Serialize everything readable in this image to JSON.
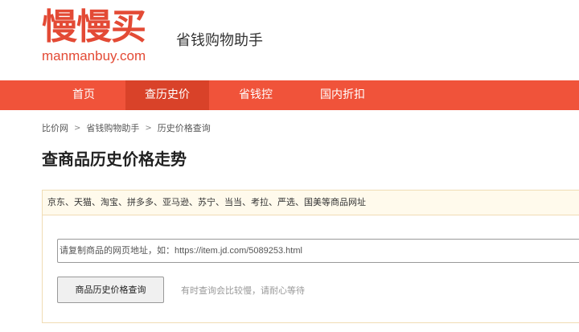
{
  "logo": {
    "cn": "慢慢买",
    "en": "manmanbuy.com"
  },
  "slogan": "省钱购物助手",
  "nav": {
    "items": [
      {
        "label": "首页"
      },
      {
        "label": "查历史价"
      },
      {
        "label": "省钱控"
      },
      {
        "label": "国内折扣"
      }
    ],
    "active_index": 1
  },
  "breadcrumb": {
    "items": [
      "比价网",
      "省钱购物助手",
      "历史价格查询"
    ],
    "separator": ">"
  },
  "page_title": "查商品历史价格走势",
  "panel": {
    "supported_sites": "京东、天猫、淘宝、拼多多、亚马逊、苏宁、当当、考拉、严选、国美等商品网址",
    "input_placeholder": "请复制商品的网页地址，如：https://item.jd.com/5089253.html",
    "button_label": "商品历史价格查询",
    "hint": "有时查询会比较慢，请耐心等待"
  },
  "colors": {
    "brand": "#e34a35",
    "nav_bg": "#f0533a",
    "nav_active_bg": "#d94229",
    "panel_border": "#f0dcb4",
    "panel_head_bg": "#fffaec"
  }
}
